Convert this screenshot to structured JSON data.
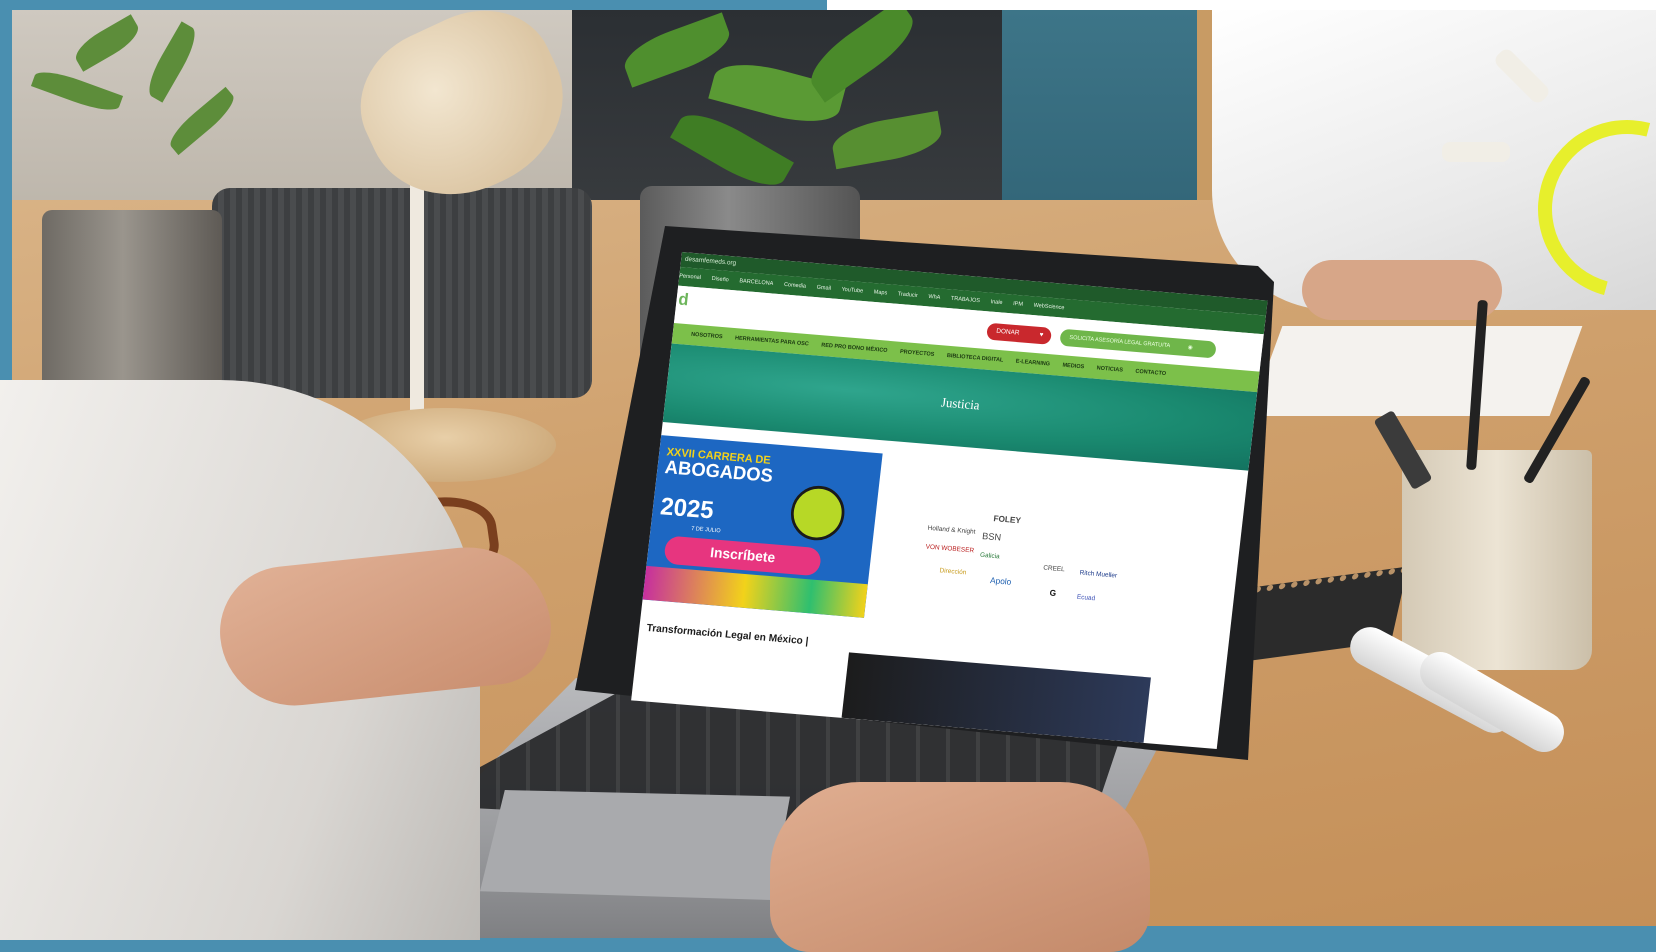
{
  "browser": {
    "address": "desamfemeds.org",
    "bookmarks": [
      "Personal",
      "Diseño",
      "BARCELONA",
      "Comedia",
      "Gmail",
      "YouTube",
      "Maps",
      "Traducir",
      "WhA",
      "TRABAJOS",
      "Inale",
      "IPM",
      "WebScience"
    ]
  },
  "site": {
    "logo_letter": "d",
    "donate_label": "DONAR",
    "legal_cta_label": "SOLICITA ASESORÍA LEGAL GRATUITA",
    "nav": [
      "NOSOTROS",
      "HERRAMIENTAS PARA OSC",
      "RED PRO BONO MÉXICO",
      "PROYECTOS",
      "BIBLIOTECA DIGITAL",
      "E-LEARNING",
      "MEDIOS",
      "NOTICIAS",
      "CONTACTO"
    ],
    "hero_title": "Justicia",
    "banner": {
      "title_line1": "XXVII CARRERA DE",
      "title_line2": "ABOGADOS",
      "year": "2025",
      "date": "7 DE JULIO",
      "button": "Inscríbete"
    },
    "sponsor_logos": [
      "FOLEY",
      "Holland & Knight",
      "BSN",
      "VON WOBESER",
      "Galicia",
      "CREEL",
      "Ritch Mueller",
      "Dirección",
      "Apolo",
      "G",
      "Ecuad"
    ],
    "article_title": "Transformación Legal en México |"
  },
  "colors": {
    "frame": "#4a8fb0",
    "browser_bar": "#246b30",
    "nav_green": "#7cc04a",
    "hero_teal": "#1a8a70",
    "donate_red": "#c9282d",
    "cta_green": "#6fb64a",
    "banner_blue": "#1d67c2",
    "banner_pink": "#e7357f",
    "sun_yellow": "#e7ef2c"
  }
}
